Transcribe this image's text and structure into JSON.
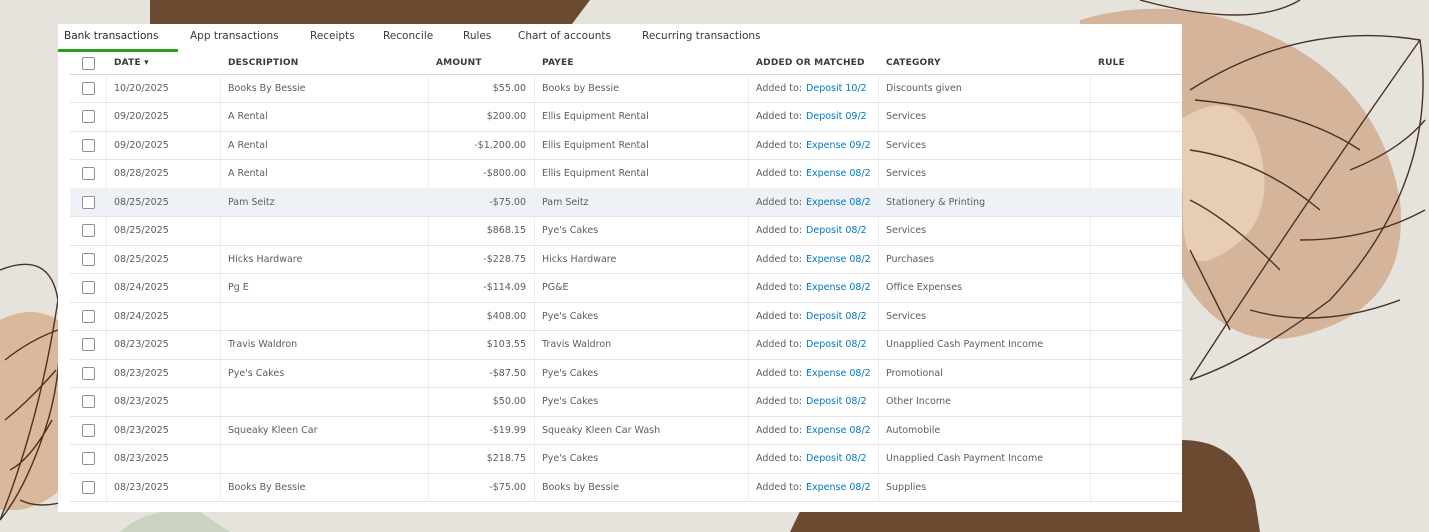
{
  "tabs": [
    {
      "label": "Bank transactions",
      "active": true
    },
    {
      "label": "App transactions"
    },
    {
      "label": "Receipts"
    },
    {
      "label": "Reconcile"
    },
    {
      "label": "Rules"
    },
    {
      "label": "Chart of accounts"
    },
    {
      "label": "Recurring transactions"
    }
  ],
  "columns": {
    "date": "DATE",
    "sort_icon": "▾",
    "description": "DESCRIPTION",
    "amount": "AMOUNT",
    "payee": "PAYEE",
    "added_or_matched": "ADDED OR MATCHED",
    "category": "CATEGORY",
    "rule": "RULE"
  },
  "added_prefix": "Added to:",
  "rows": [
    {
      "date": "10/20/2025",
      "description": "Books By Bessie",
      "amount": "$55.00",
      "payee": "Books by Bessie",
      "link": "Deposit 10/2",
      "category": "Discounts given"
    },
    {
      "date": "09/20/2025",
      "description": "A Rental",
      "amount": "$200.00",
      "payee": "Ellis Equipment Rental",
      "link": "Deposit 09/2",
      "category": "Services"
    },
    {
      "date": "09/20/2025",
      "description": "A Rental",
      "amount": "-$1,200.00",
      "payee": "Ellis Equipment Rental",
      "link": "Expense 09/2",
      "category": "Services"
    },
    {
      "date": "08/28/2025",
      "description": "A Rental",
      "amount": "-$800.00",
      "payee": "Ellis Equipment Rental",
      "link": "Expense 08/2",
      "category": "Services"
    },
    {
      "date": "08/25/2025",
      "description": "Pam Seitz",
      "amount": "-$75.00",
      "payee": "Pam Seitz",
      "link": "Expense 08/2",
      "category": "Stationery & Printing"
    },
    {
      "date": "08/25/2025",
      "description": "",
      "amount": "$868.15",
      "payee": "Pye's Cakes",
      "link": "Deposit 08/2",
      "category": "Services"
    },
    {
      "date": "08/25/2025",
      "description": "Hicks Hardware",
      "amount": "-$228.75",
      "payee": "Hicks Hardware",
      "link": "Expense 08/2",
      "category": "Purchases"
    },
    {
      "date": "08/24/2025",
      "description": "Pg E",
      "amount": "-$114.09",
      "payee": "PG&E",
      "link": "Expense 08/2",
      "category": "Office Expenses"
    },
    {
      "date": "08/24/2025",
      "description": "",
      "amount": "$408.00",
      "payee": "Pye's Cakes",
      "link": "Deposit 08/2",
      "category": "Services"
    },
    {
      "date": "08/23/2025",
      "description": "Travis Waldron",
      "amount": "$103.55",
      "payee": "Travis Waldron",
      "link": "Deposit 08/2",
      "category": "Unapplied Cash Payment Income"
    },
    {
      "date": "08/23/2025",
      "description": "Pye's Cakes",
      "amount": "-$87.50",
      "payee": "Pye's Cakes",
      "link": "Expense 08/2",
      "category": "Promotional"
    },
    {
      "date": "08/23/2025",
      "description": "",
      "amount": "$50.00",
      "payee": "Pye's Cakes",
      "link": "Deposit 08/2",
      "category": "Other Income"
    },
    {
      "date": "08/23/2025",
      "description": "Squeaky Kleen Car",
      "amount": "-$19.99",
      "payee": "Squeaky Kleen Car Wash",
      "link": "Expense 08/2",
      "category": "Automobile"
    },
    {
      "date": "08/23/2025",
      "description": "",
      "amount": "$218.75",
      "payee": "Pye's Cakes",
      "link": "Deposit 08/2",
      "category": "Unapplied Cash Payment Income"
    },
    {
      "date": "08/23/2025",
      "description": "Books By Bessie",
      "amount": "-$75.00",
      "payee": "Books by Bessie",
      "link": "Expense 08/2",
      "category": "Supplies"
    }
  ],
  "highlighted_row": 4,
  "colors": {
    "accent": "#2ca01c",
    "link": "#0077c5",
    "leaf_tan": "#d9b89c",
    "blob_brown": "#6b4a32"
  }
}
